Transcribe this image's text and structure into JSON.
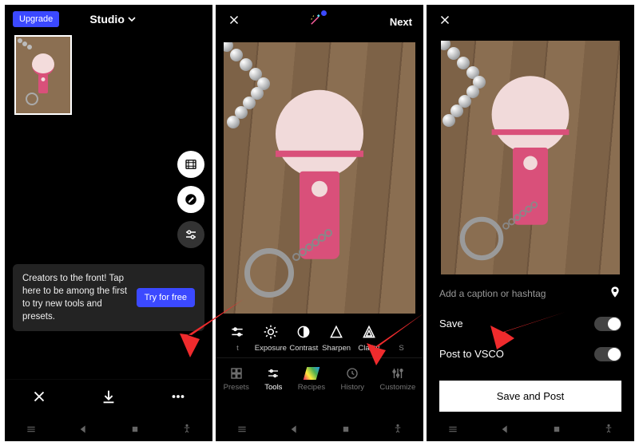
{
  "panel1": {
    "upgrade_label": "Upgrade",
    "header_title": "Studio",
    "banner_text": "Creators to the front! Tap here to be among the first to try new tools and presets.",
    "try_label": "Try for free"
  },
  "panel2": {
    "next_label": "Next",
    "tools": [
      {
        "label": "t"
      },
      {
        "label": "Exposure"
      },
      {
        "label": "Contrast"
      },
      {
        "label": "Sharpen"
      },
      {
        "label": "Clarity"
      },
      {
        "label": "S"
      }
    ],
    "bottom_tabs": [
      {
        "label": "Presets"
      },
      {
        "label": "Tools"
      },
      {
        "label": "Recipes"
      },
      {
        "label": "History"
      },
      {
        "label": "Customize"
      }
    ]
  },
  "panel3": {
    "caption_placeholder": "Add a caption or hashtag",
    "save_label": "Save",
    "post_vsco_label": "Post to VSCO",
    "save_post_label": "Save and Post"
  }
}
